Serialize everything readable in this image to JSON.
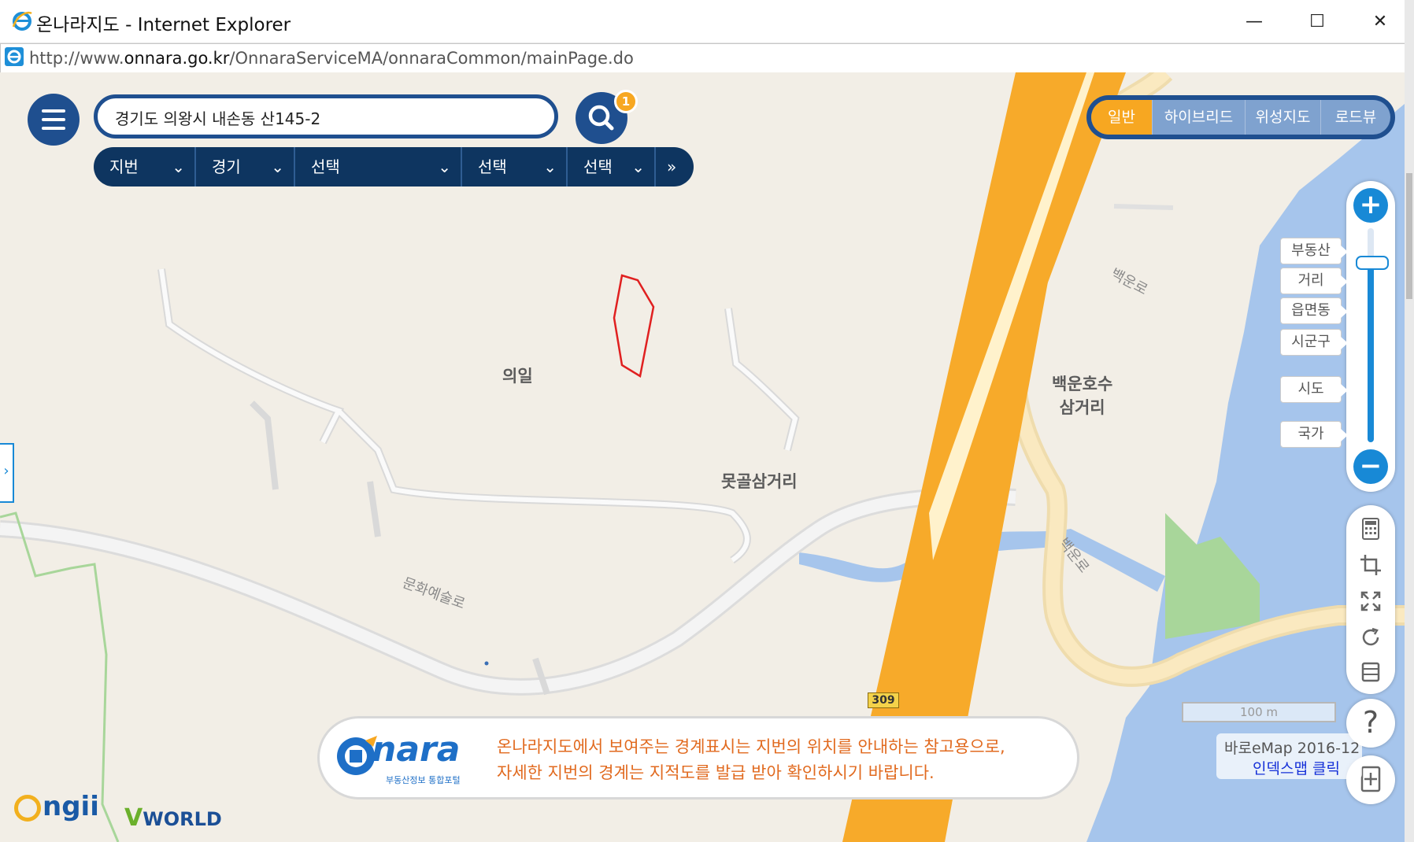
{
  "window": {
    "title": "온나라지도 - Internet Explorer",
    "url_prefix": "http://www.",
    "url_domain": "onnara.go.kr",
    "url_path": "/OnnaraServiceMA/onnaraCommon/mainPage.do",
    "controls": {
      "minimize": "—",
      "maximize": "☐",
      "close": "✕"
    }
  },
  "search": {
    "value": "경기도 의왕시 내손동 산145-2",
    "badge_count": "1"
  },
  "selectors": [
    {
      "label": "지번"
    },
    {
      "label": "경기"
    },
    {
      "label": "선택"
    },
    {
      "label": "선택"
    },
    {
      "label": "선택"
    }
  ],
  "map_types": {
    "items": [
      "일반",
      "하이브리드",
      "위성지도",
      "로드뷰"
    ],
    "active": "일반"
  },
  "zoom": {
    "plus": "+",
    "minus": "−",
    "levels": [
      "부동산",
      "거리",
      "읍면동",
      "시군구",
      "시도",
      "국가"
    ]
  },
  "map_labels": {
    "place1": "의일",
    "place2": "못골삼거리",
    "place3_line1": "백운호수",
    "place3_line2": "삼거리",
    "road1": "백운로",
    "road2": "백운로",
    "road3": "문화예술로",
    "route": "309"
  },
  "scale": {
    "label": "100 m"
  },
  "notice": {
    "logo_text": "nara",
    "logo_sub": "부동산정보 통합포털",
    "line1": "온나라지도에서 보여주는 경계표시는 지번의 위치를 안내하는 참고용으로,",
    "line2": "자세한 지번의 경계는 지적도를 발급 받아 확인하시기 바랍니다."
  },
  "bareu": {
    "line1": "바로eMap 2016-12",
    "line2": "인덱스맵 클릭"
  },
  "logos": {
    "ngii": "ngii",
    "vworld": "WORLD"
  },
  "help": {
    "label": "?"
  },
  "colors": {
    "brand_blue": "#1f4f8f",
    "accent_orange": "#f7a721",
    "zoom_blue": "#1889d6",
    "notice_text": "#e16a1f",
    "parcel_outline": "#e02020"
  }
}
